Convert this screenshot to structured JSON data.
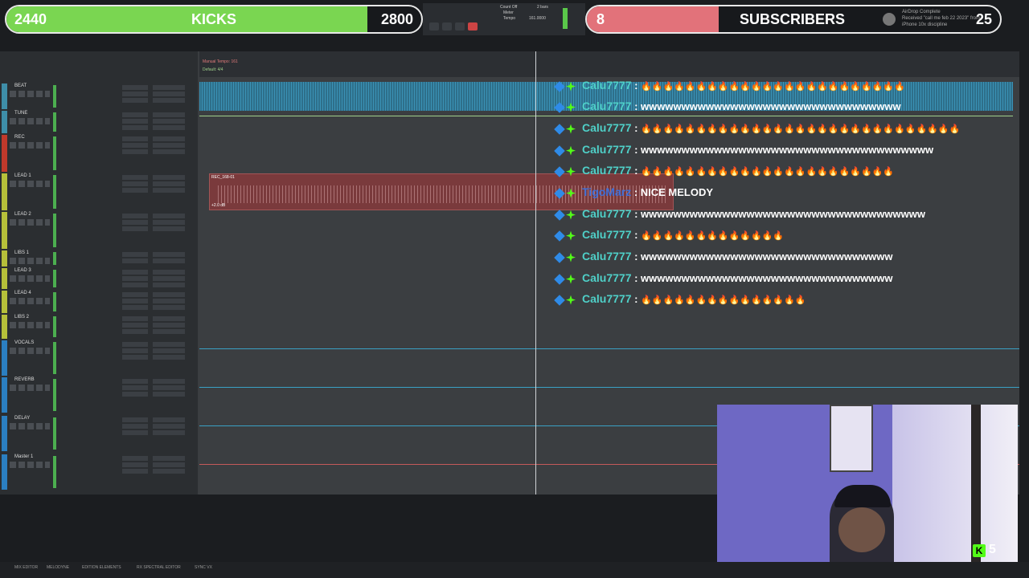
{
  "goal_bars": {
    "kicks": {
      "current": "2440",
      "label": "KICKS",
      "target": "2800",
      "progress": 0.871,
      "color": "#7ad651"
    },
    "subscribers": {
      "current": "8",
      "label": "SUBSCRIBERS",
      "target": "25",
      "progress": 0.32,
      "color": "#e2727a"
    }
  },
  "notification": {
    "line1": "AirDrop Complete",
    "line2": "Received \"call me feb 22 2023\" from",
    "line3": "iPhone 10x discipline"
  },
  "transport": {
    "count_off": "Count Off",
    "meter": "Meter",
    "tempo": "Tempo",
    "tempo_value": "161.0000",
    "bars": "2 bars"
  },
  "ruler": {
    "tempo_label": "Manual Tempo: 161",
    "meter_label": "Default: 4/4"
  },
  "tracks": [
    {
      "name": "BEAT",
      "color": "#3e8ea8"
    },
    {
      "name": "TUNE",
      "color": "#3e8ea8"
    },
    {
      "name": "REC",
      "color": "#c0392b"
    },
    {
      "name": "LEAD 1",
      "color": "#b6c03a"
    },
    {
      "name": "LEAD 2",
      "color": "#b6c03a"
    },
    {
      "name": "LIBS 1",
      "color": "#b6c03a"
    },
    {
      "name": "LEAD 3",
      "color": "#b6c03a"
    },
    {
      "name": "LEAD 4",
      "color": "#b6c03a"
    },
    {
      "name": "LIBS 2",
      "color": "#b6c03a"
    },
    {
      "name": "VOCALS",
      "color": "#2b7fc1"
    },
    {
      "name": "REVERB",
      "color": "#2b7fc1"
    },
    {
      "name": "DELAY",
      "color": "#2b7fc1"
    },
    {
      "name": "Master 1",
      "color": "#2b7fc1"
    }
  ],
  "clips": {
    "rec_clip_name": "REC_168-01",
    "rec_clip_gain": "+2.0 dB"
  },
  "chat": [
    {
      "user": "Calu7777",
      "message": "🔥🔥🔥🔥🔥🔥🔥🔥🔥🔥🔥🔥🔥🔥🔥🔥🔥🔥🔥🔥🔥🔥🔥🔥",
      "user_color": "#4fd0c8"
    },
    {
      "user": "Calu7777",
      "message": "wwwwwwwwwwwwwwwwwwwwwwwwwwwwwwww",
      "user_color": "#4fd0c8"
    },
    {
      "user": "Calu7777",
      "message": "🔥🔥🔥🔥🔥🔥🔥🔥🔥🔥🔥🔥🔥🔥🔥🔥🔥🔥🔥🔥🔥🔥🔥🔥🔥🔥🔥🔥🔥",
      "user_color": "#4fd0c8"
    },
    {
      "user": "Calu7777",
      "message": "wwwwwwwwwwwwwwwwwwwwwwwwwwwwwwwwwwww",
      "user_color": "#4fd0c8"
    },
    {
      "user": "Calu7777",
      "message": "🔥🔥🔥🔥🔥🔥🔥🔥🔥🔥🔥🔥🔥🔥🔥🔥🔥🔥🔥🔥🔥🔥🔥",
      "user_color": "#4fd0c8"
    },
    {
      "user": "TigoMarz",
      "message": "NICE MELODY",
      "user_color": "#3f6fd8"
    },
    {
      "user": "Calu7777",
      "message": "wwwwwwwwwwwwwwwwwwwwwwwwwwwwwwwwwww",
      "user_color": "#4fd0c8"
    },
    {
      "user": "Calu7777",
      "message": "🔥🔥🔥🔥🔥🔥🔥🔥🔥🔥🔥🔥🔥",
      "user_color": "#4fd0c8"
    },
    {
      "user": "Calu7777",
      "message": "wwwwwwwwwwwwwwwwwwwwwwwwwwwwwww",
      "user_color": "#4fd0c8"
    },
    {
      "user": "Calu7777",
      "message": "wwwwwwwwwwwwwwwwwwwwwwwwwwwwwww",
      "user_color": "#4fd0c8"
    },
    {
      "user": "Calu7777",
      "message": "🔥🔥🔥🔥🔥🔥🔥🔥🔥🔥🔥🔥🔥🔥🔥",
      "user_color": "#4fd0c8"
    }
  ],
  "webcam": {
    "kick_count": "5"
  },
  "bottom_bar": [
    "MIX EDITOR",
    "MELODYNE",
    "EDITION ELEMENTS",
    "RX SPECTRAL EDITOR",
    "SYNC VX"
  ]
}
